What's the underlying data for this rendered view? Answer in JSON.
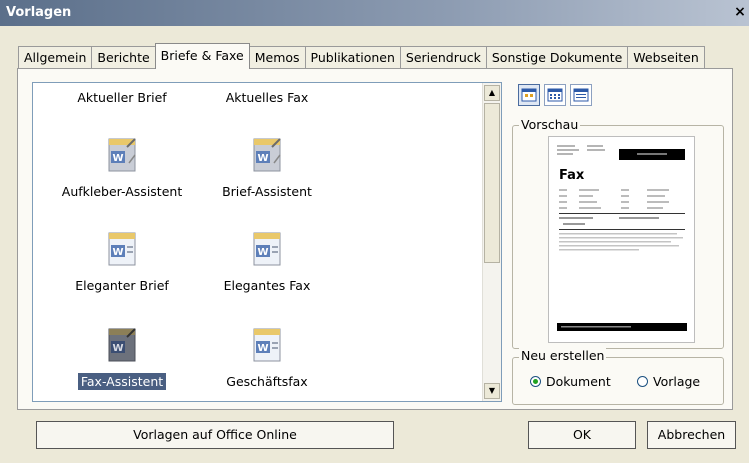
{
  "window": {
    "title": "Vorlagen",
    "close_glyph": "×"
  },
  "tabs": [
    {
      "label": "Allgemein",
      "active": false
    },
    {
      "label": "Berichte",
      "active": false
    },
    {
      "label": "Briefe & Faxe",
      "active": true
    },
    {
      "label": "Memos",
      "active": false
    },
    {
      "label": "Publikationen",
      "active": false
    },
    {
      "label": "Seriendruck",
      "active": false
    },
    {
      "label": "Sonstige Dokumente",
      "active": false
    },
    {
      "label": "Webseiten",
      "active": false
    }
  ],
  "templates": [
    {
      "label": "Aktueller Brief",
      "icon": "none"
    },
    {
      "label": "Aktuelles Fax",
      "icon": "none"
    },
    {
      "label": "Aufkleber-Assistent",
      "icon": "wizard-icon"
    },
    {
      "label": "Brief-Assistent",
      "icon": "wizard-icon"
    },
    {
      "label": "Eleganter Brief",
      "icon": "word-doc-icon"
    },
    {
      "label": "Elegantes Fax",
      "icon": "word-doc-icon"
    },
    {
      "label": "Fax-Assistent",
      "icon": "wizard-icon",
      "selected": true
    },
    {
      "label": "Geschäftsfax",
      "icon": "word-doc-icon"
    }
  ],
  "preview": {
    "group_label": "Vorschau",
    "doc_heading": "Fax"
  },
  "create_new": {
    "group_label": "Neu erstellen",
    "options": [
      {
        "label": "Dokument",
        "selected": true
      },
      {
        "label": "Vorlage",
        "selected": false
      }
    ]
  },
  "buttons": {
    "online": "Vorlagen auf Office Online",
    "ok": "OK",
    "cancel": "Abbrechen"
  },
  "colors": {
    "dialog_bg": "#ece9d8",
    "selection": "#4a5f82",
    "title_bar": "#5b6f8a"
  }
}
